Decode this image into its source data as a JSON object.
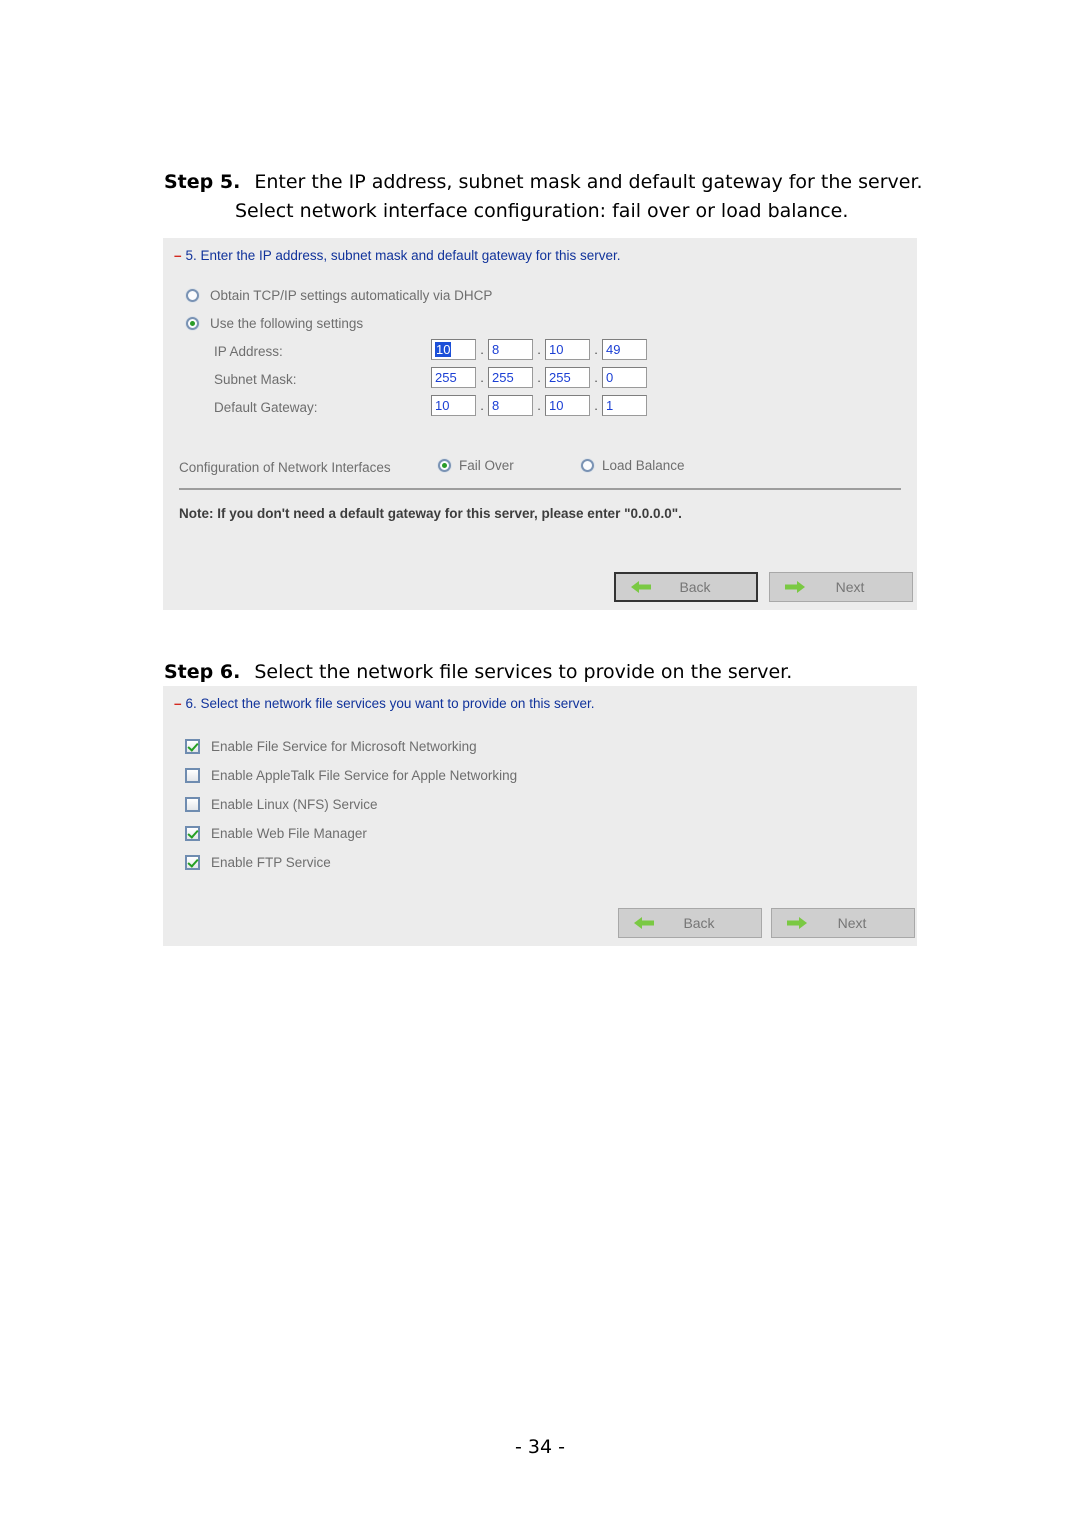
{
  "document": {
    "page_number": "- 34 -"
  },
  "step5": {
    "label": "Step 5.",
    "text": "Enter the IP address, subnet mask and default gateway for the server.",
    "subtext": "Select network interface configuration: fail over or load balance.",
    "panel": {
      "title_dash": "–",
      "title": "5. Enter the IP address, subnet mask and default gateway for this server.",
      "radios": [
        {
          "label": "Obtain TCP/IP settings automatically via DHCP",
          "checked": false
        },
        {
          "label": "Use the following settings",
          "checked": true
        }
      ],
      "fields": [
        {
          "label": "IP Address:",
          "octets": [
            "10",
            "8",
            "10",
            "49"
          ],
          "selected_octet": 0
        },
        {
          "label": "Subnet Mask:",
          "octets": [
            "255",
            "255",
            "255",
            "0"
          ],
          "selected_octet": -1
        },
        {
          "label": "Default Gateway:",
          "octets": [
            "10",
            "8",
            "10",
            "1"
          ],
          "selected_octet": -1
        }
      ],
      "separator_dot": ".",
      "interfaces": {
        "label": "Configuration of Network Interfaces",
        "options": [
          {
            "label": "Fail Over",
            "checked": true
          },
          {
            "label": "Load Balance",
            "checked": false
          }
        ]
      },
      "note": "Note: If you don't need a default gateway for this server, please enter \"0.0.0.0\".",
      "buttons": {
        "back": "Back",
        "next": "Next",
        "back_focused": true
      }
    }
  },
  "step6": {
    "label": "Step 6.",
    "text": "Select the network file services to provide on the server.",
    "panel": {
      "title_dash": "–",
      "title": "6. Select the network file services you want to provide on this server.",
      "services": [
        {
          "label": "Enable File Service for Microsoft Networking",
          "checked": true
        },
        {
          "label": "Enable AppleTalk File Service for Apple Networking",
          "checked": false
        },
        {
          "label": "Enable Linux (NFS) Service",
          "checked": false
        },
        {
          "label": "Enable Web File Manager",
          "checked": true
        },
        {
          "label": "Enable FTP Service",
          "checked": true
        }
      ],
      "buttons": {
        "back": "Back",
        "next": "Next",
        "back_focused": false
      }
    }
  },
  "colors": {
    "panel_bg": "#ececec",
    "title_blue": "#11339b",
    "dash_red": "#d42a20",
    "input_text_blue": "#1b3fd4",
    "selection_blue": "#1b4fd8",
    "arrow_green": "#7ac943",
    "check_green": "#25a023"
  }
}
